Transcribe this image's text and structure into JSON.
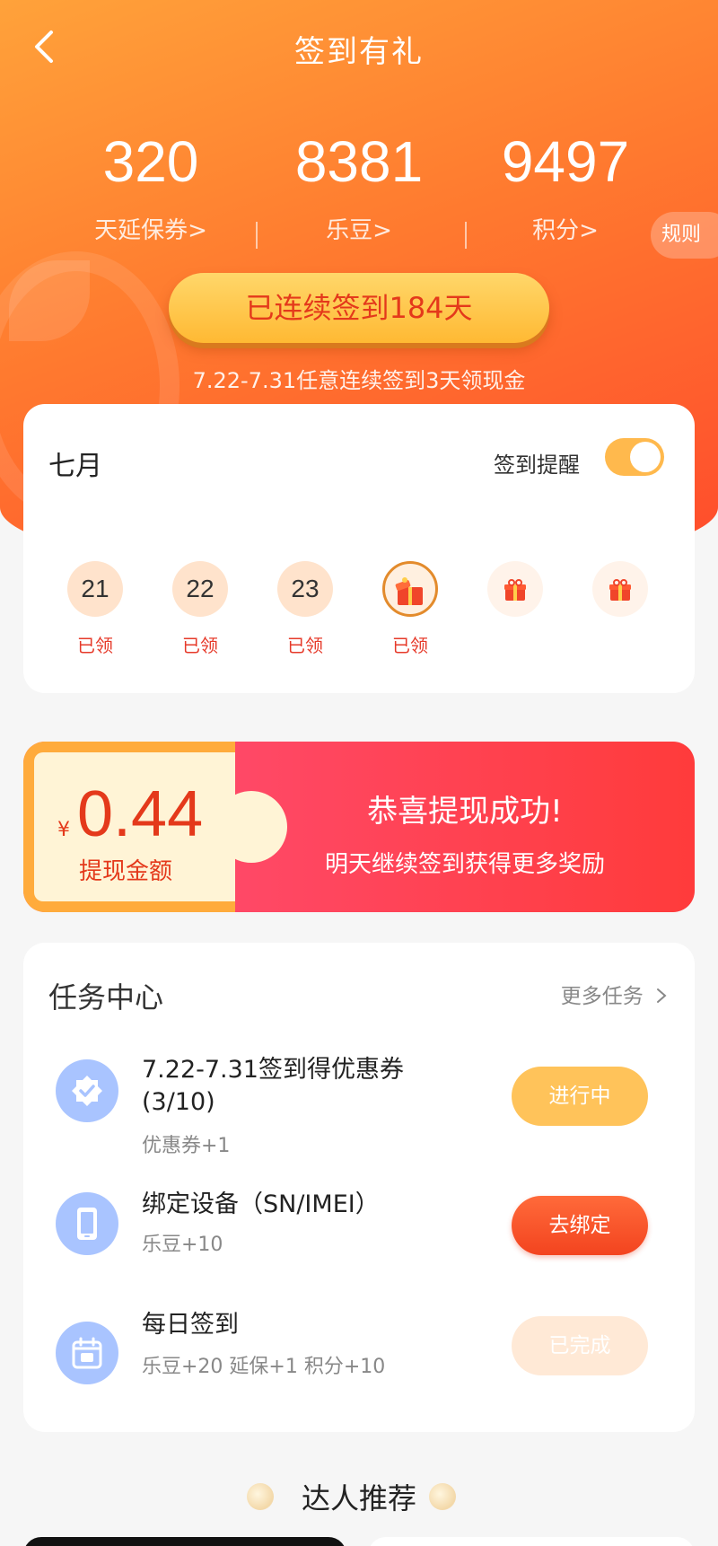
{
  "header": {
    "title": "签到有礼"
  },
  "stats": [
    {
      "value": "320",
      "label": "天延保券>"
    },
    {
      "value": "8381",
      "label": "乐豆>"
    },
    {
      "value": "9497",
      "label": "积分>"
    }
  ],
  "rules_label": "规则",
  "streak": {
    "button_label": "已连续签到184天",
    "hint": "7.22-7.31任意连续签到3天领现金"
  },
  "calendar": {
    "month": "七月",
    "reminder_label": "签到提醒",
    "reminder_on": true,
    "days": [
      {
        "day": "21",
        "state": "已领"
      },
      {
        "day": "22",
        "state": "已领"
      },
      {
        "day": "23",
        "state": "已领"
      },
      {
        "day": "",
        "state": "已领",
        "icon": "gift-open-icon"
      },
      {
        "day": "",
        "state": "",
        "icon": "gift-icon"
      },
      {
        "day": "",
        "state": "",
        "icon": "gift-icon"
      }
    ]
  },
  "withdraw": {
    "currency": "¥",
    "amount": "0.44",
    "amount_label": "提现金额",
    "title": "恭喜提现成功!",
    "subtitle": "明天继续签到获得更多奖励"
  },
  "tasks": {
    "title": "任务中心",
    "more_label": "更多任务",
    "items": [
      {
        "name": "7.22-7.31签到得优惠券 (3/10)",
        "reward": "优惠券+1",
        "button": "进行中",
        "icon": "badge-check-icon"
      },
      {
        "name": "绑定设备（SN/IMEI）",
        "reward": "乐豆+10",
        "button": "去绑定",
        "icon": "phone-icon"
      },
      {
        "name": "每日签到",
        "reward": "乐豆+20 延保+1 积分+10",
        "button": "已完成",
        "icon": "calendar-sign-icon"
      }
    ]
  },
  "recommend": {
    "title": "达人推荐"
  },
  "colors": {
    "brand_orange": "#ff7a2f",
    "accent_red": "#e4391b",
    "button_yellow": "#ffc35a"
  }
}
